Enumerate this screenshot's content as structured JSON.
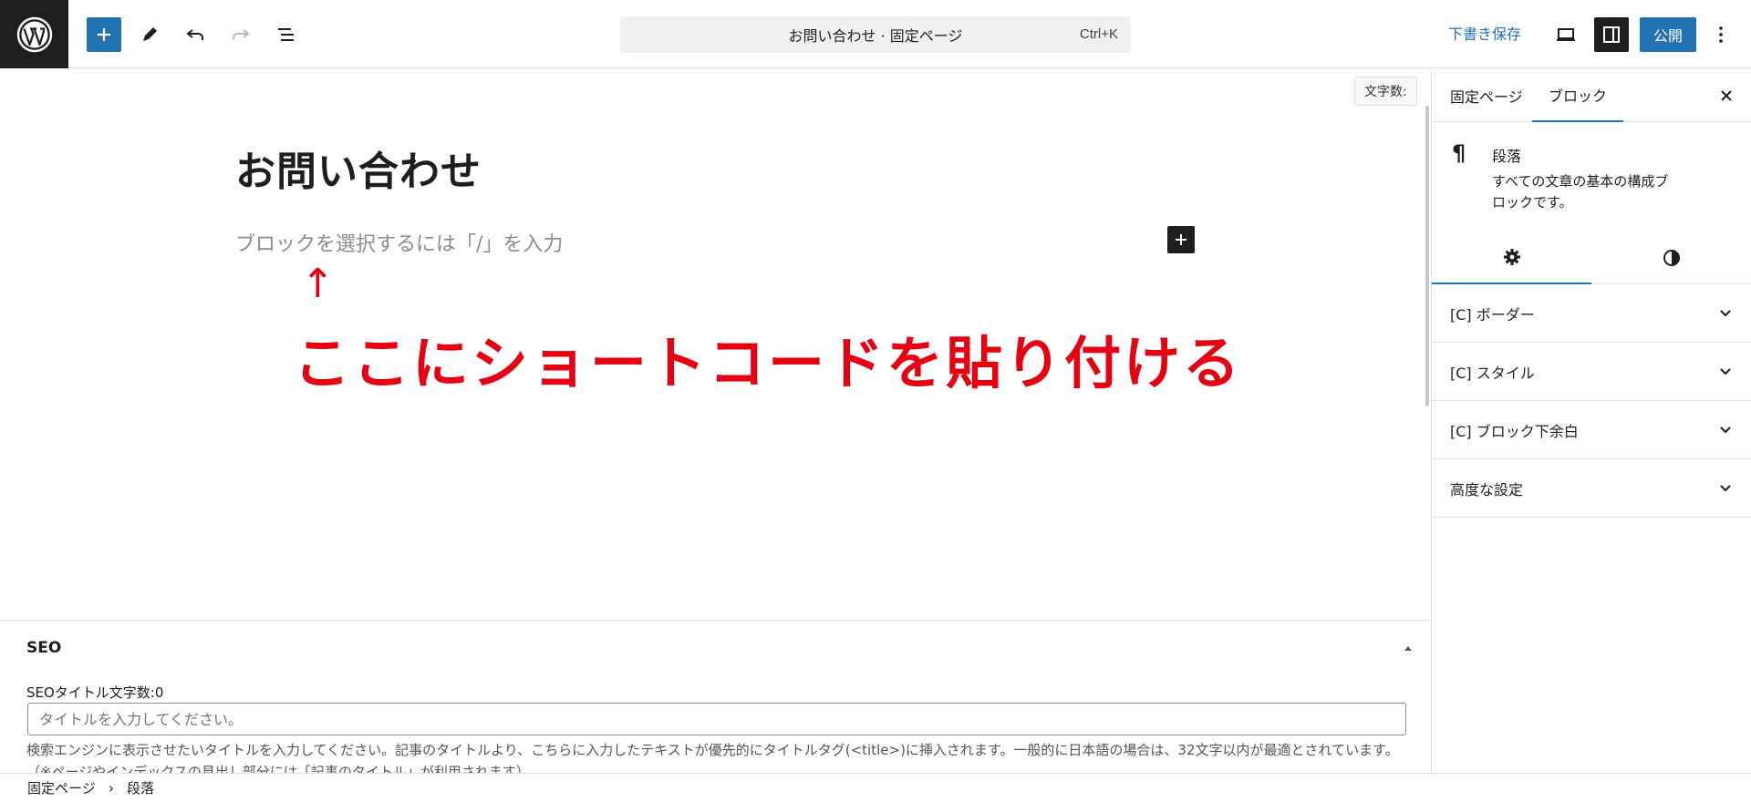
{
  "topbar": {
    "document_title": "お問い合わせ · 固定ページ",
    "shortcut": "Ctrl+K",
    "save_draft_label": "下書き保存",
    "publish_label": "公開",
    "accent_color": "#2271b1"
  },
  "editor": {
    "char_count_label": "文字数:",
    "post_title": "お問い合わせ",
    "block_placeholder": "ブロックを選択するには「/」を入力"
  },
  "annotation": {
    "arrow": "↑",
    "text": "ここにショートコードを貼り付ける",
    "color": "#e60012"
  },
  "seo": {
    "heading": "SEO",
    "title_count_label": "SEOタイトル文字数:0",
    "title_placeholder": "タイトルを入力してください。",
    "help_text": "検索エンジンに表示させたいタイトルを入力してください。記事のタイトルより、こちらに入力したテキストが優先的にタイトルタグ(<title>)に挿入されます。一般的に日本語の場合は、32文字以内が最適とされています。（※ページやインデックスの見出し部分には「記事のタイトル」が利用されます）"
  },
  "breadcrumb": {
    "items": [
      "固定ページ",
      "段落"
    ],
    "separator": "›"
  },
  "sidebar": {
    "tabs": [
      "固定ページ",
      "ブロック"
    ],
    "active_tab": "ブロック",
    "block": {
      "icon": "¶",
      "name": "段落",
      "description": "すべての文章の基本の構成ブロックです。"
    },
    "panels": [
      {
        "label": "[C] ボーダー"
      },
      {
        "label": "[C] スタイル"
      },
      {
        "label": "[C] ブロック下余白"
      },
      {
        "label": "高度な設定"
      }
    ]
  }
}
